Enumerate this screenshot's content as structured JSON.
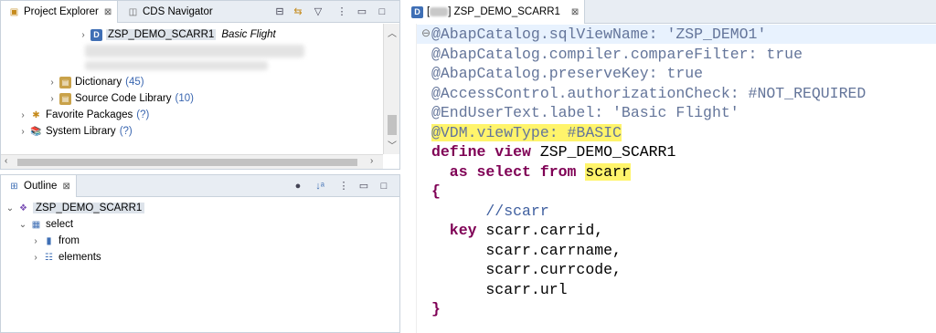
{
  "project_explorer": {
    "tab_label": "Project Explorer",
    "tab_close": "⊠",
    "cds_tab_label": "CDS Navigator",
    "tree": [
      {
        "type": "ddl",
        "name": "ZSP_DEMO_SCARR1",
        "desc": "Basic Flight"
      },
      {
        "type": "folder",
        "name": "Dictionary",
        "count": "(45)"
      },
      {
        "type": "folder",
        "name": "Source Code Library",
        "count": "(10)"
      },
      {
        "type": "fav",
        "name": "Favorite Packages",
        "count": "(?)"
      },
      {
        "type": "lib",
        "name": "System Library",
        "count": "(?)"
      }
    ]
  },
  "outline": {
    "tab_label": "Outline",
    "tab_close": "⊠",
    "tree": [
      {
        "name": "ZSP_DEMO_SCARR1"
      },
      {
        "name": "select"
      },
      {
        "name": "from"
      },
      {
        "name": "elements"
      }
    ]
  },
  "editor": {
    "tab_prefix": "[",
    "tab_suffix": "] ZSP_DEMO_SCARR1",
    "tab_close": "⊠",
    "fold_marker": "⊖",
    "lines": {
      "l1": "@AbapCatalog.sqlViewName: 'ZSP_DEMO1'",
      "l2": "@AbapCatalog.compiler.compareFilter: true",
      "l3": "@AbapCatalog.preserveKey: true",
      "l4": "@AccessControl.authorizationCheck: #NOT_REQUIRED",
      "l5": "@EndUserText.label: 'Basic Flight'",
      "l6": "@VDM.viewType: #BASIC",
      "l7_kw": "define view",
      "l7_id": " ZSP_DEMO_SCARR1",
      "l8_kw": "  as select from",
      "l8_hl": "scarr",
      "l9": "{",
      "l10": "      //scarr",
      "l11_kw": "  key",
      "l11_id": " scarr.carrid,",
      "l12": "      scarr.carrname,",
      "l13": "      scarr.currcode,",
      "l14": "      scarr.url",
      "l15": "}"
    }
  }
}
